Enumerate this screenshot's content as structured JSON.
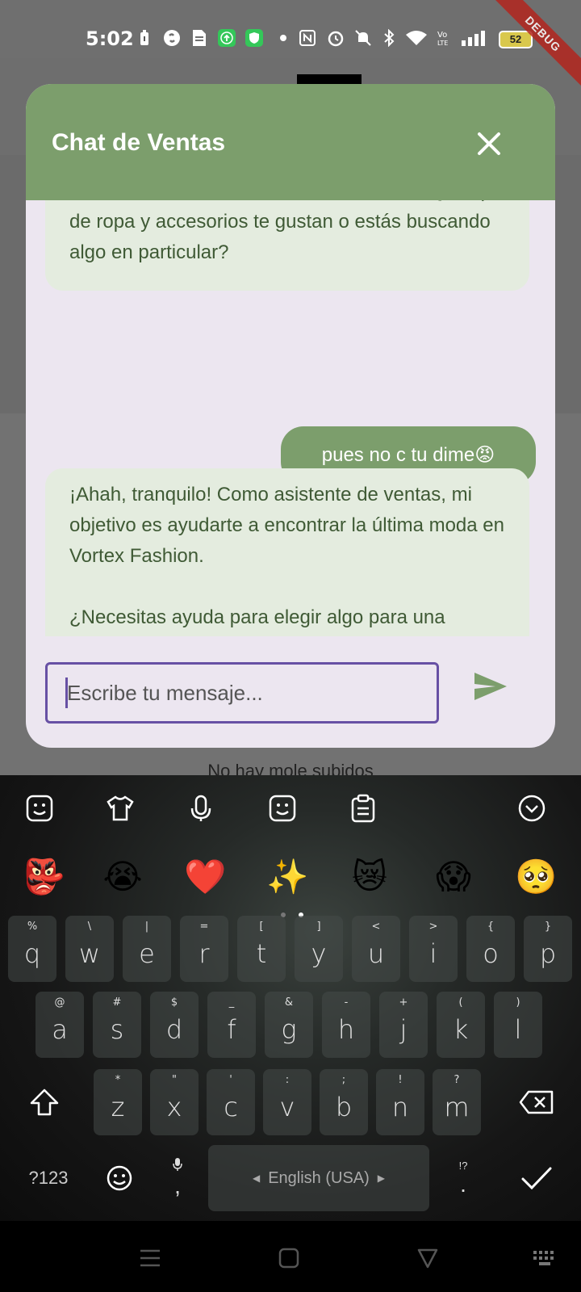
{
  "status_bar": {
    "time": "5:02",
    "battery": "52",
    "debug_label": "DEBUG"
  },
  "background": {
    "partial_text": "No hay mole subidos"
  },
  "dialog": {
    "title": "Chat de Ventas",
    "messages": [
      {
        "from": "bot",
        "text": "decidido visitar nuestra tienda de moda. ¿Qué tipo de ropa y accesorios te gustan o estás buscando algo en particular?"
      },
      {
        "from": "user",
        "text": "pues no c tu dime😡"
      },
      {
        "from": "bot",
        "text": "¡Ahah, tranquilo! Como asistente de ventas, mi objetivo es ayudarte a encontrar la última moda en Vortex Fashion.\n\n¿Necesitas ayuda para elegir algo para una ocasión especial o simplemente buscas actualizar tu estilo básico? ¿Qué estilo de ropa te gustaría explorar? Tenemos una"
      }
    ],
    "input_placeholder": "Escribe tu mensaje...",
    "accent_color": "#7c9e6c",
    "focus_color": "#6750a4"
  },
  "keyboard": {
    "emojis": [
      "👺",
      "😭",
      "❤️",
      "✨",
      "😿",
      "😱",
      "🥺"
    ],
    "row1": [
      {
        "alt": "%",
        "key": "q"
      },
      {
        "alt": "\\",
        "key": "w"
      },
      {
        "alt": "|",
        "key": "e"
      },
      {
        "alt": "=",
        "key": "r"
      },
      {
        "alt": "[",
        "key": "t"
      },
      {
        "alt": "]",
        "key": "y"
      },
      {
        "alt": "<",
        "key": "u"
      },
      {
        "alt": ">",
        "key": "i"
      },
      {
        "alt": "{",
        "key": "o"
      },
      {
        "alt": "}",
        "key": "p"
      }
    ],
    "row2": [
      {
        "alt": "@",
        "key": "a"
      },
      {
        "alt": "#",
        "key": "s"
      },
      {
        "alt": "$",
        "key": "d"
      },
      {
        "alt": "_",
        "key": "f"
      },
      {
        "alt": "&",
        "key": "g"
      },
      {
        "alt": "-",
        "key": "h"
      },
      {
        "alt": "+",
        "key": "j"
      },
      {
        "alt": "(",
        "key": "k"
      },
      {
        "alt": ")",
        "key": "l"
      }
    ],
    "row3": [
      {
        "alt": "*",
        "key": "z"
      },
      {
        "alt": "\"",
        "key": "x"
      },
      {
        "alt": "'",
        "key": "c"
      },
      {
        "alt": ":",
        "key": "v"
      },
      {
        "alt": ";",
        "key": "b"
      },
      {
        "alt": "!",
        "key": "n"
      },
      {
        "alt": "?",
        "key": "m"
      }
    ],
    "symbols_label": "?123",
    "comma": ",",
    "language": "English (USA)",
    "period_alt": "!?",
    "period": "."
  }
}
